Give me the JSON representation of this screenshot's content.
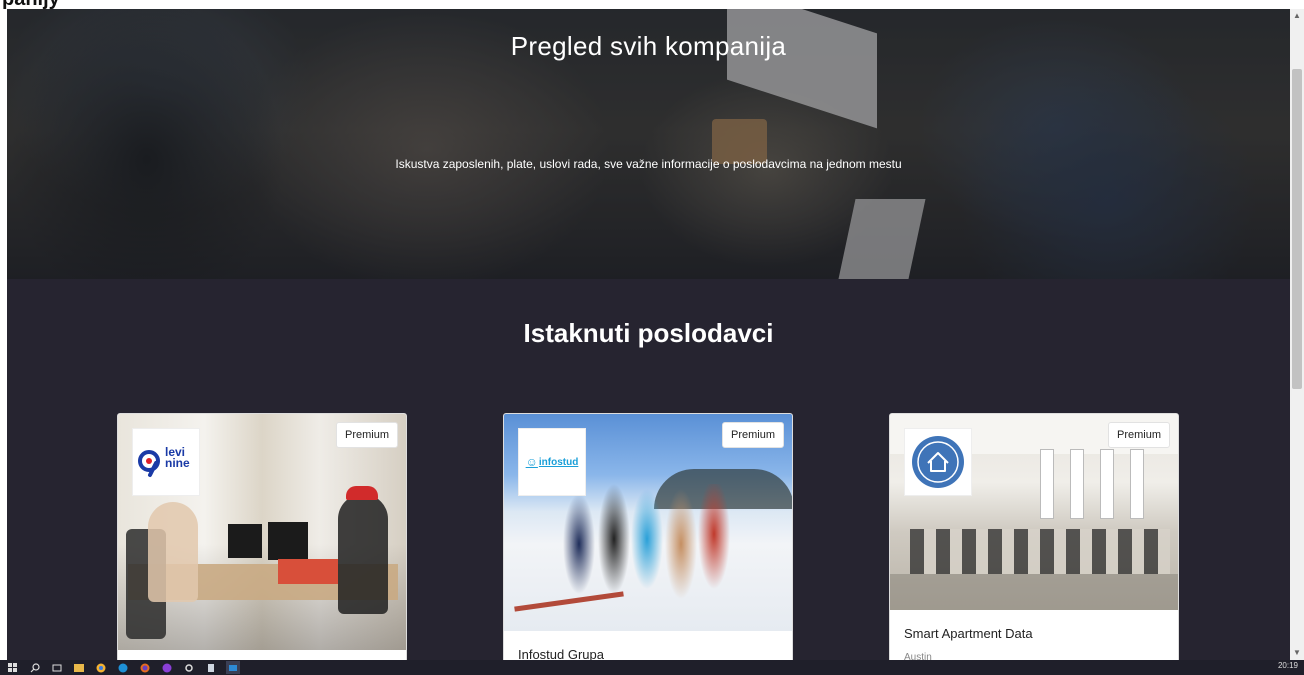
{
  "page": {
    "cut_heading": "panijy"
  },
  "hero": {
    "title": "Pregled svih kompanija",
    "subtitle": "Iskustva zaposlenih, plate, uslovi rada, sve važne informacije o poslodavcima na jednom mestu"
  },
  "featured": {
    "title": "Istaknuti poslodavci",
    "cards": [
      {
        "badge": "Premium",
        "logo_text_top": "levi",
        "logo_text_bottom": "nine",
        "name": "",
        "location": ""
      },
      {
        "badge": "Premium",
        "logo_text": "infostud",
        "name": "Infostud Grupa",
        "location": ""
      },
      {
        "badge": "Premium",
        "logo_icon": "house-icon",
        "name": "Smart Apartment Data",
        "location": "Austin"
      }
    ]
  },
  "taskbar": {
    "time": "20:19",
    "icons": [
      "windows-start-icon",
      "search-icon",
      "task-view-icon",
      "file-explorer-icon",
      "chrome-icon",
      "edge-icon",
      "firefox-icon",
      "firefox-dev-icon",
      "settings-icon",
      "app-icon",
      "active-window-icon"
    ]
  },
  "colors": {
    "page_bg": "#262430",
    "card_bg": "#ffffff",
    "levi_blue": "#1a3aa6",
    "infostud_blue": "#1a9fd8",
    "sad_blue": "#3f74b8"
  }
}
